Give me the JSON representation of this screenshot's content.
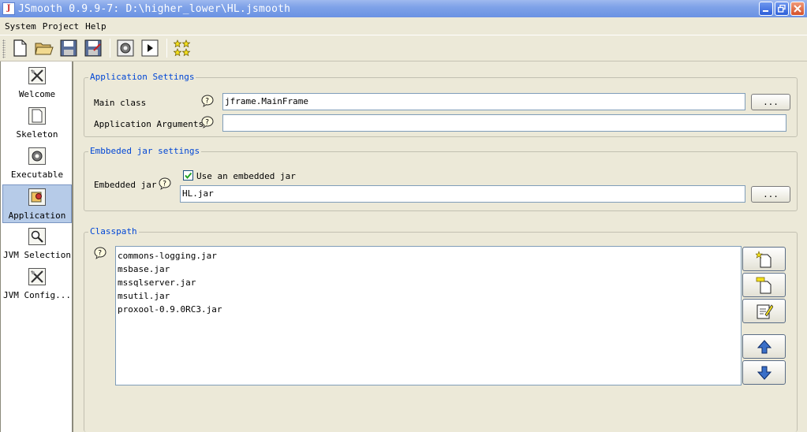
{
  "window": {
    "title": "JSmooth 0.9.9-7: D:\\higher_lower\\HL.jsmooth",
    "icon": "java-cup-icon"
  },
  "menu": [
    "System",
    "Project",
    "Help"
  ],
  "toolbar": {
    "buttons": [
      "new-file-icon",
      "open-folder-icon",
      "save-icon",
      "save-as-icon",
      "compile-gear-icon",
      "run-icon",
      "stars-icon"
    ]
  },
  "sidebar": {
    "items": [
      {
        "label": "Welcome",
        "icon": "tools-icon"
      },
      {
        "label": "Skeleton",
        "icon": "page-icon"
      },
      {
        "label": "Executable",
        "icon": "gear-icon"
      },
      {
        "label": "Application",
        "icon": "application-icon",
        "selected": true
      },
      {
        "label": "JVM Selection",
        "icon": "magnifier-icon"
      },
      {
        "label": "JVM Config...",
        "icon": "tools-icon"
      }
    ]
  },
  "app_settings": {
    "title": "Application Settings",
    "main_class_label": "Main class",
    "main_class_value": "jframe.MainFrame",
    "args_label": "Application Arguments",
    "args_value": "",
    "browse_label": "..."
  },
  "embedded": {
    "title": "Embbeded jar settings",
    "label": "Embedded jar",
    "checkbox_label": "Use an embedded jar",
    "checked": true,
    "value": "HL.jar",
    "browse_label": "..."
  },
  "classpath": {
    "title": "Classpath",
    "items": [
      "commons-logging.jar",
      "msbase.jar",
      "mssqlserver.jar",
      "msutil.jar",
      "proxool-0.9.0RC3.jar"
    ],
    "buttons": [
      "add-icon",
      "add-folder-icon",
      "edit-icon",
      "move-up-icon",
      "move-down-icon"
    ]
  }
}
